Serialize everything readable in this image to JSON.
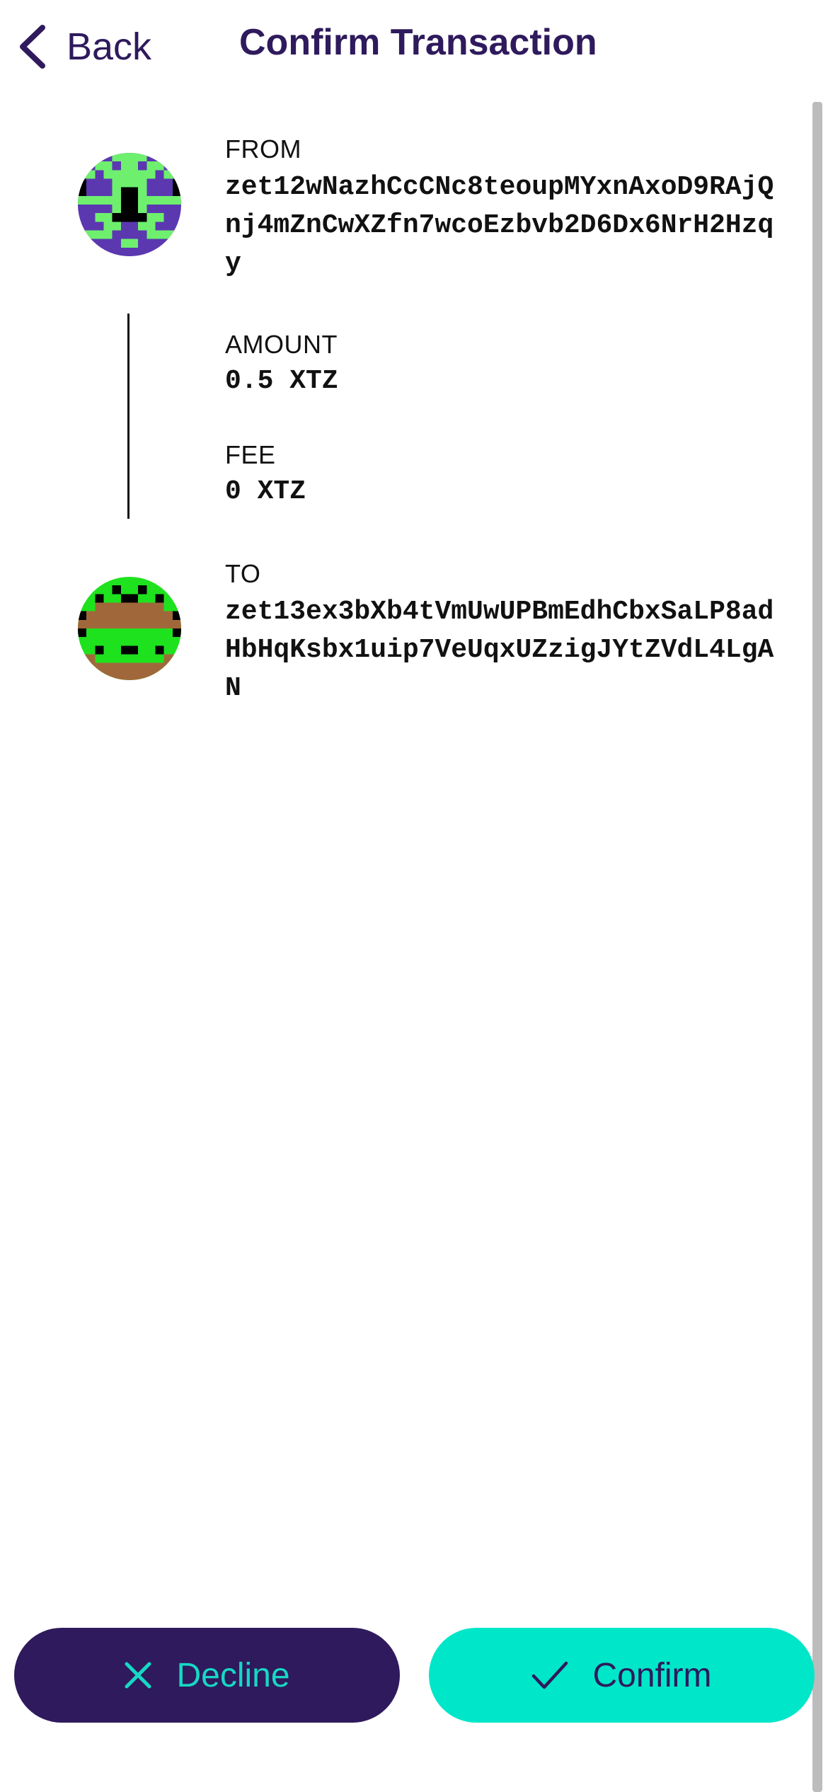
{
  "header": {
    "back_label": "Back",
    "title": "Confirm Transaction"
  },
  "transaction": {
    "from": {
      "label": "FROM",
      "address": "zet12wNazhCcCNc8teoupMYxnAxoD9RAjQnj4mZnCwXZfn7wcoEzbvb2D6Dx6NrH2Hzqy"
    },
    "amount": {
      "label": "AMOUNT",
      "value": "0.5 XTZ"
    },
    "fee": {
      "label": "FEE",
      "value": "0 XTZ"
    },
    "to": {
      "label": "TO",
      "address": "zet13ex3bXb4tVmUwUPBmEdhCbxSaLP8adHbHqKsbx1uip7VeUqxUZzigJYtZVdL4LgAN"
    }
  },
  "actions": {
    "decline_label": "Decline",
    "confirm_label": "Confirm"
  },
  "colors": {
    "primary": "#2e1a5c",
    "accent": "#00e6c9",
    "background": "#ffffff"
  },
  "icons": {
    "back": "chevron-left-icon",
    "decline": "close-icon",
    "confirm": "checkmark-icon"
  }
}
